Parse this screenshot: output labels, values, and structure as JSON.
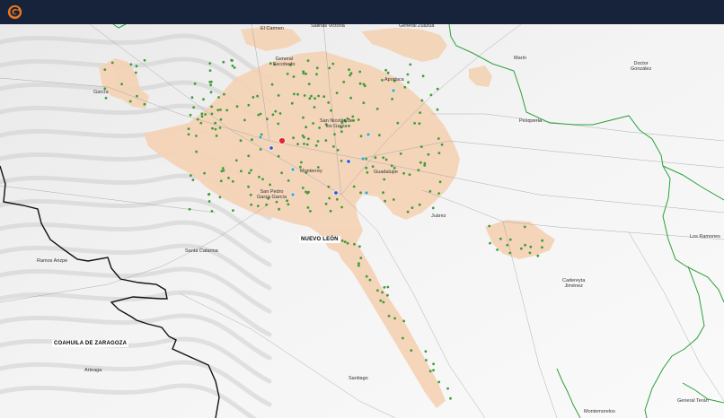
{
  "app": {
    "logo_icon": "brand-logo-icon",
    "accent": "#e8761f",
    "header_bg": "#17223b"
  },
  "map": {
    "colors": {
      "urban": "#f4d3b5",
      "stop": "#3f9d3a",
      "highlight": "#e3262b",
      "poi_blue": "#2a5bd7",
      "poi_cyan": "#3aa7c9",
      "municipal_border": "#2aa13a",
      "state_border": "#111111"
    },
    "states": {
      "nuevo_leon": "NUEVO LEÓN",
      "coahuila": "COAHUILA DE ZARAGOZA"
    },
    "places": {
      "el_carmen": "El Carmen",
      "salinas_victoria": "Salinas Victoria",
      "general_zuazua": "General Zuazua",
      "marin": "Marín",
      "doctor_gonzalez_1": "Doctor",
      "doctor_gonzalez_2": "González",
      "general_escobedo_1": "General",
      "general_escobedo_2": "Escobedo",
      "apodaca": "Apodaca",
      "garcia": "García",
      "pesqueria": "Pesquería",
      "san_nicolas_1": "San Nicolás de",
      "san_nicolas_2": "los Garza",
      "monterrey": "Monterrey",
      "guadalupe": "Guadalupe",
      "san_pedro_1": "San Pedro",
      "san_pedro_2": "Garza García",
      "juarez": "Juárez",
      "santa_catarina": "Santa Catarina",
      "ramos_arizpe": "Ramos Arizpe",
      "cadereyta_1": "Cadereyta",
      "cadereyta_2": "Jiménez",
      "los_ramones": "Los Ramones",
      "santiago": "Santiago",
      "arteaga": "Arteaga",
      "montemorelos": "Montemorelos",
      "general_teran": "General Terán"
    }
  }
}
